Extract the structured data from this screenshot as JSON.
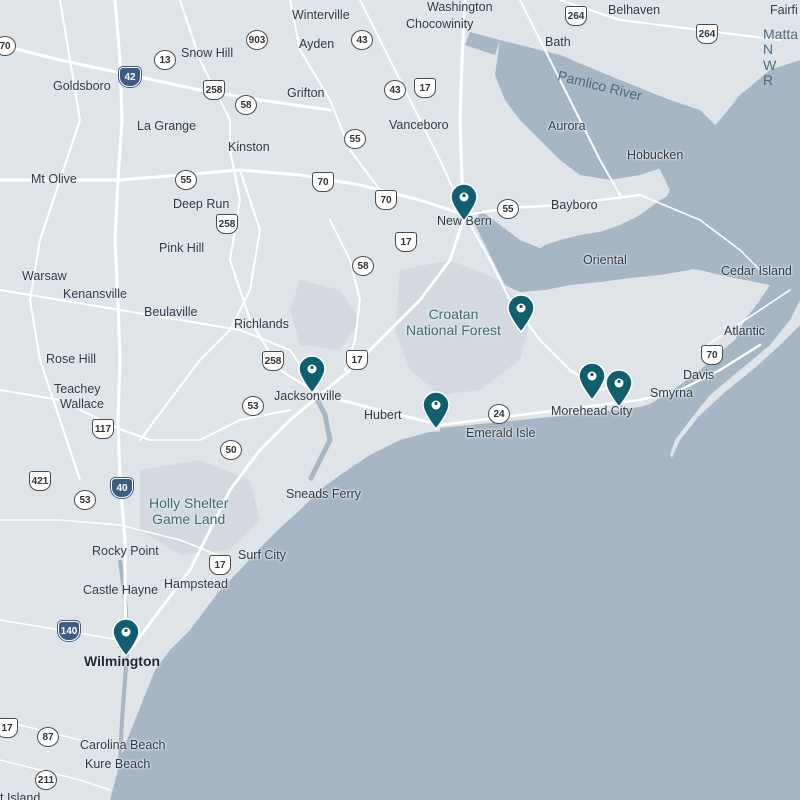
{
  "labels": {
    "winterville": "Winterville",
    "washington": "Washington",
    "chocowinity": "Chocowinity",
    "belhaven": "Belhaven",
    "fairfield": "Fairfi",
    "mattamuskeet": "Matta\nN\nW\nR",
    "snow_hill": "Snow Hill",
    "ayden": "Ayden",
    "bath": "Bath",
    "pamlico_river": "Pamlico River",
    "goldsboro": "Goldsboro",
    "grifton": "Grifton",
    "la_grange": "La Grange",
    "vanceboro": "Vanceboro",
    "aurora": "Aurora",
    "kinston": "Kinston",
    "hobucken": "Hobucken",
    "mt_olive": "Mt Olive",
    "deep_run": "Deep Run",
    "new_bern": "New Bern",
    "bayboro": "Bayboro",
    "pink_hill": "Pink Hill",
    "oriental": "Oriental",
    "warsaw": "Warsaw",
    "cedar_island": "Cedar Island",
    "kenansville": "Kenansville",
    "beulaville": "Beulaville",
    "richlands": "Richlands",
    "croatan": "Croatan\nNational Forest",
    "atlantic": "Atlantic",
    "rose_hill": "Rose Hill",
    "teachey": "Teachey",
    "wallace": "Wallace",
    "jacksonville": "Jacksonville",
    "davis": "Davis",
    "smyrna": "Smyrna",
    "hubert": "Hubert",
    "morehead_city": "Morehead City",
    "emerald_isle": "Emerald Isle",
    "holly_shelter": "Holly Shelter\nGame Land",
    "sneads_ferry": "Sneads Ferry",
    "rocky_point": "Rocky Point",
    "surf_city": "Surf City",
    "hampstead": "Hampstead",
    "castle_hayne": "Castle Hayne",
    "wilmington": "Wilmington",
    "carolina_beach": "Carolina Beach",
    "kure_beach": "Kure Beach",
    "bald_island": "t Island"
  },
  "shields": {
    "s70_top": "70",
    "s13": "13",
    "s903": "903",
    "s43_top": "43",
    "s264_a": "264",
    "s264_b": "264",
    "s42": "42",
    "s258_a": "258",
    "s58_a": "58",
    "s43_b": "43",
    "s17_a": "17",
    "s55_a": "55",
    "s55_b": "55",
    "s70_b": "70",
    "s70_c": "70",
    "s55_c": "55",
    "s258_b": "258",
    "s17_b": "17",
    "s58_b": "58",
    "s258_c": "258",
    "s17_c": "17",
    "s53_a": "53",
    "s24": "24",
    "s70_d": "70",
    "s117": "117",
    "s50": "50",
    "s421": "421",
    "s40": "40",
    "s53_b": "53",
    "s17_d": "17",
    "s140": "140",
    "s17_e": "17",
    "s87": "87",
    "s211": "211"
  },
  "markers": [
    {
      "name": "New Bern"
    },
    {
      "name": "Croatan National Forest"
    },
    {
      "name": "Jacksonville"
    },
    {
      "name": "Hubert"
    },
    {
      "name": "Morehead City west"
    },
    {
      "name": "Morehead City east"
    },
    {
      "name": "Wilmington"
    }
  ],
  "colors": {
    "land": "#dfe4e9",
    "water": "#a6b6c5",
    "marker": "#0f5f6e",
    "road": "#ffffff"
  }
}
